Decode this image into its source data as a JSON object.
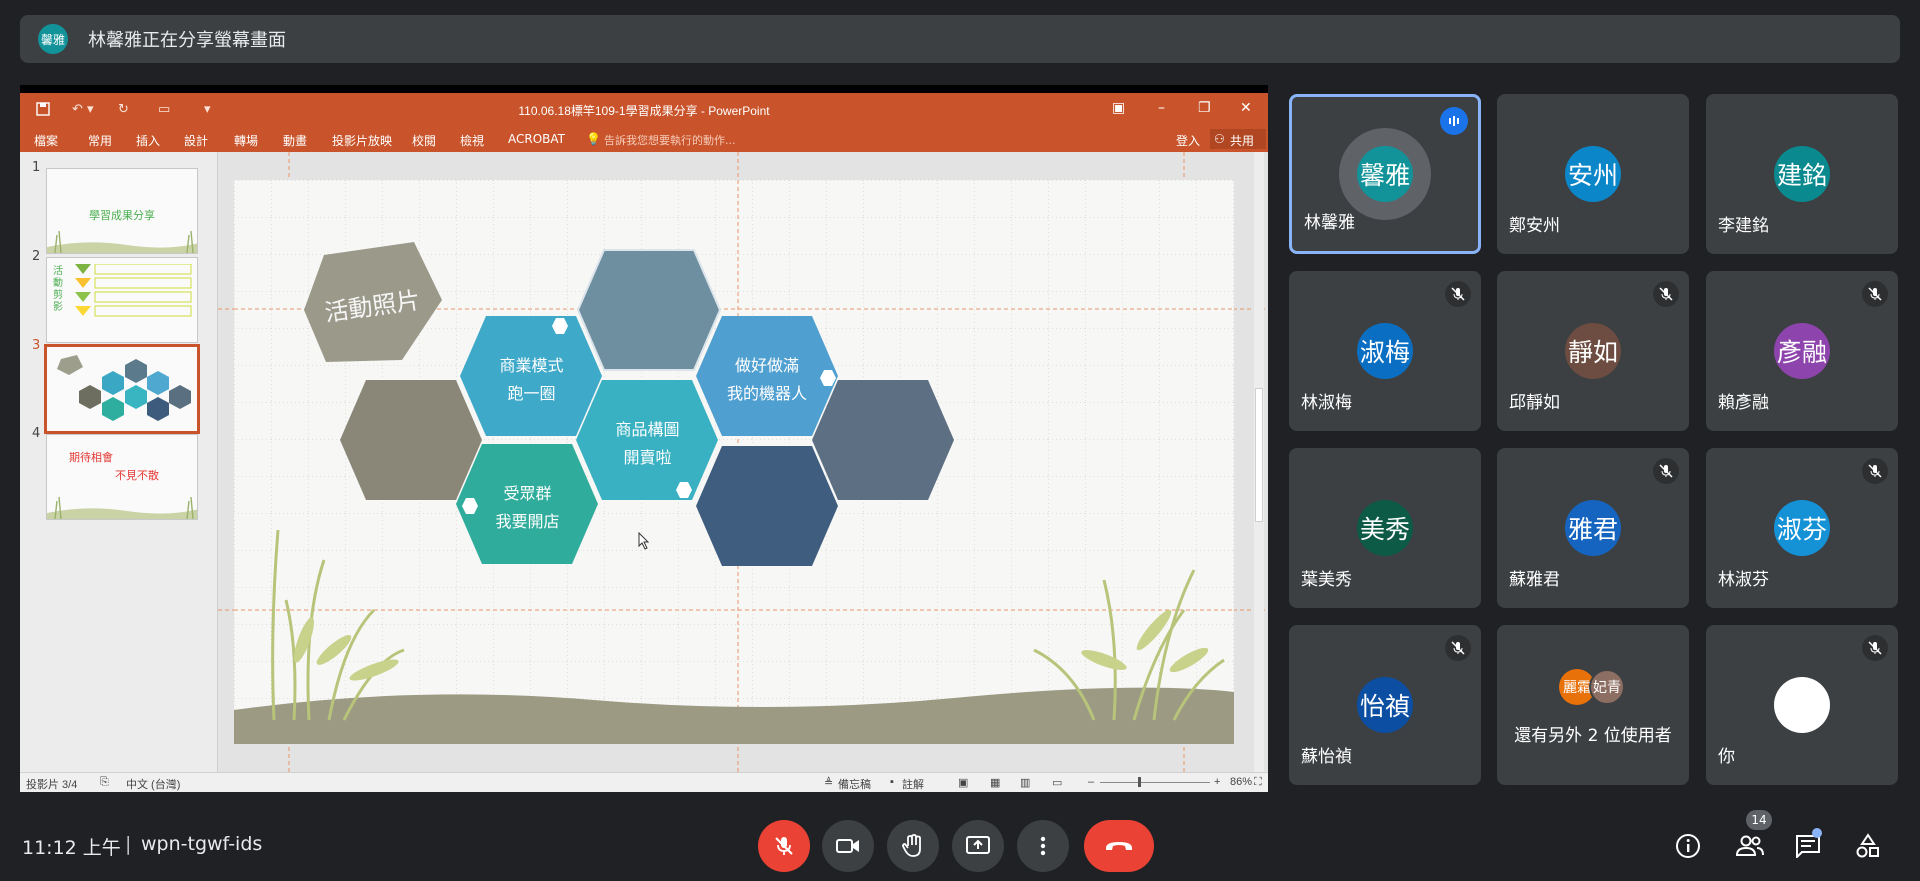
{
  "banner": {
    "avatar": "馨雅",
    "text": "林馨雅正在分享螢幕畫面"
  },
  "ppt": {
    "title": "110.06.18標竿109-1學習成果分享 - PowerPoint",
    "tabs": [
      "檔案",
      "常用",
      "插入",
      "設計",
      "轉場",
      "動畫",
      "投影片放映",
      "校閱",
      "檢視",
      "ACROBAT"
    ],
    "tellme": "告訴我您想要執行的動作...",
    "signin": "登入",
    "share": "共用",
    "thumb_numbers": [
      "1",
      "2",
      "3",
      "4"
    ],
    "thumb1_title": "學習成果分享",
    "thumb2_text": "活動剪影",
    "thumb4_line1": "期待相會",
    "thumb4_line2": "不見不散",
    "slide": {
      "heading": "活動照片",
      "hex1": [
        "商業模式",
        "跑一圈"
      ],
      "hex2": [
        "商品構圖",
        "開賣啦"
      ],
      "hex3": [
        "受眾群",
        "我要開店"
      ],
      "hex4": [
        "做好做滿",
        "我的機器人"
      ]
    },
    "status": {
      "slide_of": "投影片 3/4",
      "lang": "中文 (台灣)",
      "notes": "備忘稿",
      "comments": "註解",
      "zoom": "86%"
    }
  },
  "participants": [
    {
      "name": "林馨雅",
      "avatar": "馨雅",
      "color": "#12939a",
      "speaking": true,
      "muted": false
    },
    {
      "name": "鄭安州",
      "avatar": "安州",
      "color": "#0b86c9",
      "speaking": false,
      "muted": false
    },
    {
      "name": "李建銘",
      "avatar": "建銘",
      "color": "#0a8a8f",
      "speaking": false,
      "muted": false
    },
    {
      "name": "林淑梅",
      "avatar": "淑梅",
      "color": "#0a6fc2",
      "speaking": false,
      "muted": true
    },
    {
      "name": "邱靜如",
      "avatar": "靜如",
      "color": "#6d4c41",
      "speaking": false,
      "muted": true
    },
    {
      "name": "賴彥融",
      "avatar": "彥融",
      "color": "#8e44ad",
      "speaking": false,
      "muted": true
    },
    {
      "name": "葉美秀",
      "avatar": "美秀",
      "color": "#0d5a46",
      "speaking": false,
      "muted": false
    },
    {
      "name": "蘇雅君",
      "avatar": "雅君",
      "color": "#1565c0",
      "speaking": false,
      "muted": true
    },
    {
      "name": "林淑芬",
      "avatar": "淑芬",
      "color": "#1591d6",
      "speaking": false,
      "muted": true
    },
    {
      "name": "蘇怡禎",
      "avatar": "怡禎",
      "color": "#0b4ea2",
      "speaking": false,
      "muted": true
    }
  ],
  "others": {
    "text": "還有另外 2 位使用者",
    "avatar1": "麗霜",
    "avatar2": "妃青",
    "color1": "#e8710a",
    "color2": "#8d6e63"
  },
  "self": {
    "name": "你"
  },
  "bottom": {
    "time": "11:12 上午",
    "sep": "|",
    "code": "wpn-tgwf-ids",
    "people_count": "14"
  }
}
